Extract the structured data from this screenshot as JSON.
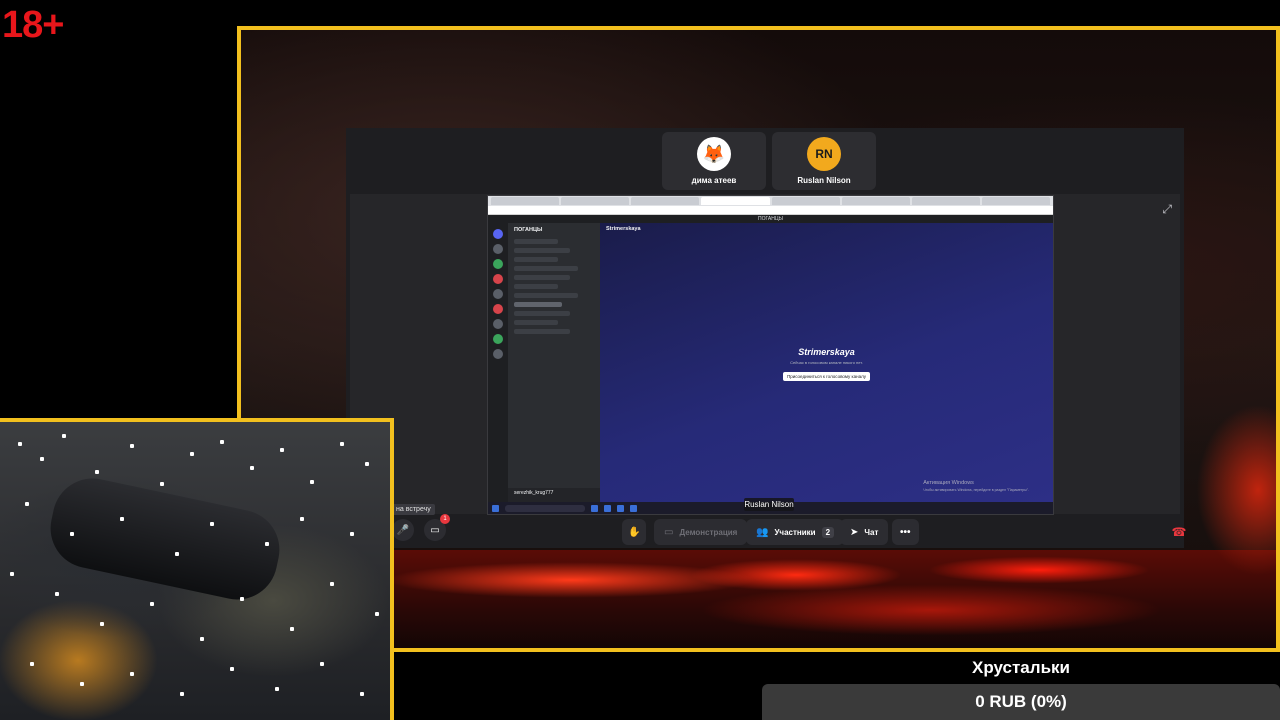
{
  "overlay": {
    "age_rating": "18+"
  },
  "conference": {
    "participants": [
      {
        "name": "дима атеев",
        "avatar_icon": "fox-icon",
        "avatar_text": "🦊"
      },
      {
        "name": "Ruslan Nilson",
        "avatar_text": "RN",
        "avatar_color": "#f2a91d"
      }
    ],
    "active_speaker_label": "Ruslan Nilson",
    "join_tooltip": "на встречу",
    "notification_count": "1",
    "controls": {
      "raise_hand_icon": "hand-icon",
      "screen_share_label": "Демонстрация",
      "participants_label": "Участники",
      "participants_count": "2",
      "chat_label": "Чат",
      "more_icon": "more-icon",
      "hangup_icon": "phone-hangup-icon"
    }
  },
  "shared_screen": {
    "discord_window_title": "ПОГАНЦЫ",
    "guild_name": "ПОГАНЦЫ",
    "channel_name": "Strimerskaya",
    "center_title": "Strimerskaya",
    "center_subtitle": "Сейчас в голосовом канале никого нет.",
    "join_button": "Присоединиться к голосовому каналу",
    "username": "serezhik_krug777",
    "activation_line1": "Активация Windows",
    "activation_line2": "Чтобы активировать Windows, перейдите в раздел \"Параметры\".",
    "taskbar_search": "Поиск"
  },
  "donation": {
    "title": "Хрустальки",
    "amount_text": "0 RUB (0%)",
    "progress_fraction": 0
  },
  "colors": {
    "frame_accent": "#f2c01e",
    "age_badge": "#e8161b",
    "hangup": "#e8373e"
  }
}
